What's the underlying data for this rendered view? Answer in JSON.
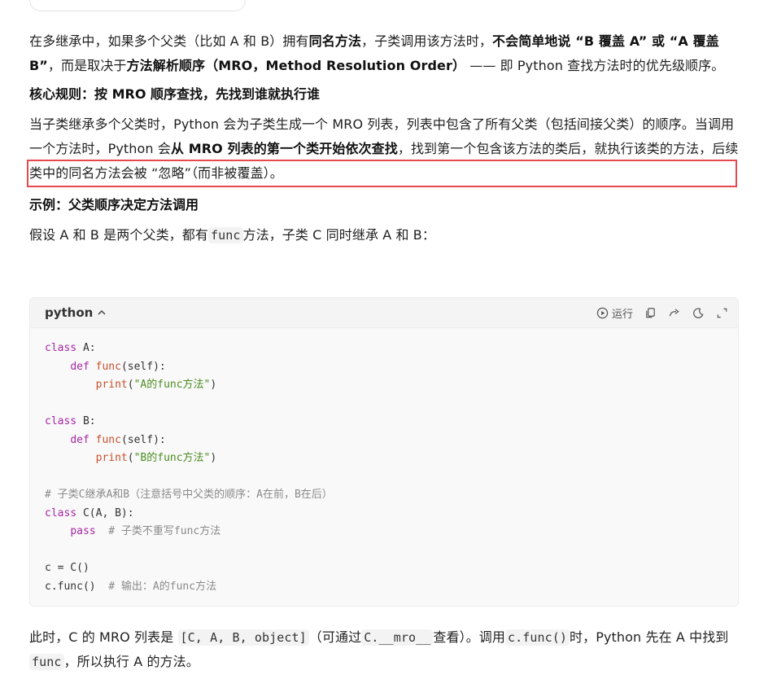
{
  "p1": {
    "t1": "在多继承中，如果多个父类（比如 A 和 B）拥有",
    "b1": "同名方法",
    "t2": "，子类调用该方法时，",
    "b2": "不会简单地说 “B 覆盖 A” 或 “A 覆盖 B”",
    "t3": "，而是取决于",
    "b3": "方法解析顺序（MRO，Method Resolution Order）",
    "t4": " —— 即 Python 查找方法时的优先级顺序。"
  },
  "h1": "核心规则：按 MRO 顺序查找，先找到谁就执行谁",
  "p2": {
    "t1": "当子类继承多个父类时，Python 会为子类生成一个 MRO 列表，列表中包含了所有父类（包括间接父类）的顺序。",
    "t2": "当调用一个方法时，Python 会",
    "b1": "从 MRO 列表的第一个类开始依次查找",
    "t3": "，找到第一个包含该方法的类后，就执行该类的方法，后续类中的同名方法会被 “忽略”（而非被覆盖）。"
  },
  "h2": "示例：父类顺序决定方法调用",
  "p3": {
    "t1": "假设 A 和 B 是两个父类，都有",
    "c1": "func",
    "t2": "方法，子类 C 同时继承 A 和 B："
  },
  "code": {
    "lang": "python",
    "run_label": "运行",
    "icons": [
      "play-icon",
      "copy-icon",
      "share-icon",
      "theme-icon",
      "expand-icon"
    ],
    "lines": {
      "l1a": "class",
      "l1b": " A:",
      "l2a": "def",
      "l2b": "func",
      "l2c": "(self):",
      "l3a": "print",
      "l3b": "(",
      "l3c": "\"A的func方法\"",
      "l3d": ")",
      "l5a": "class",
      "l5b": " B:",
      "l6a": "def",
      "l6b": "func",
      "l6c": "(self):",
      "l7a": "print",
      "l7b": "(",
      "l7c": "\"B的func方法\"",
      "l7d": ")",
      "l9": "# 子类C继承A和B（注意括号中父类的顺序：A在前，B在后）",
      "l10a": "class",
      "l10b": " C(A, B):",
      "l11a": "pass",
      "l11b": "  # 子类不重写func方法",
      "l13": "c = C()",
      "l14a": "c.func()",
      "l14b": "  # 输出：A的func方法"
    }
  },
  "p4": {
    "t1": "此时，C 的 MRO 列表是 ",
    "c1": "[C, A, B, object]",
    "t2": "（可通过",
    "c2": "C.__mro__",
    "t3": "查看）。调用",
    "c3": "c.func()",
    "t4": "时，Python 先在 A 中找到",
    "c4": "func",
    "t5": "，所以执行 A 的方法。"
  },
  "colors": {
    "highlight_border": "#e5484d",
    "keyword": "#a626a4",
    "function": "#c8502c",
    "string": "#4b8b1e",
    "comment": "#8a8a8a"
  }
}
